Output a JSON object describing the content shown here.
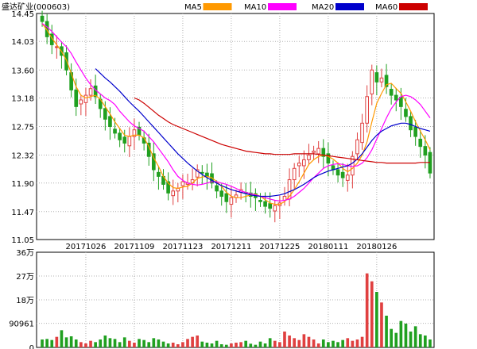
{
  "header": {
    "title": "盛达矿业(000603)"
  },
  "legend": [
    {
      "name": "MA5",
      "color": "#ff9900"
    },
    {
      "name": "MA10",
      "color": "#ff00ff"
    },
    {
      "name": "MA20",
      "color": "#0000cc"
    },
    {
      "name": "MA60",
      "color": "#cc0000"
    }
  ],
  "colors": {
    "up": "#e04040",
    "down": "#20a020",
    "grid": "#b0b0b0",
    "axis": "#000000"
  },
  "chart_data": [
    {
      "type": "candlestick",
      "ylim": [
        11.05,
        14.45
      ],
      "yticks": [
        "14.45",
        "14.03",
        "13.60",
        "13.18",
        "12.75",
        "12.32",
        "11.90",
        "11.47",
        "11.05"
      ],
      "xticks": [
        {
          "label": "20171026",
          "index": 9
        },
        {
          "label": "20171109",
          "index": 19
        },
        {
          "label": "20171123",
          "index": 29
        },
        {
          "label": "20171211",
          "index": 39
        },
        {
          "label": "20171225",
          "index": 49
        },
        {
          "label": "20180111",
          "index": 59
        },
        {
          "label": "20180126",
          "index": 69
        }
      ],
      "close": [
        14.33,
        14.1,
        13.98,
        13.95,
        13.82,
        13.6,
        13.3,
        13.05,
        13.15,
        13.22,
        13.32,
        13.2,
        13.02,
        12.86,
        12.75,
        12.65,
        12.55,
        12.5,
        12.6,
        12.7,
        12.62,
        12.5,
        12.3,
        12.1,
        12.0,
        11.88,
        11.75,
        11.78,
        11.82,
        11.92,
        11.9,
        11.95,
        12.1,
        12.05,
        12.0,
        11.9,
        11.78,
        11.7,
        11.62,
        11.68,
        11.72,
        11.8,
        11.75,
        11.7,
        11.68,
        11.62,
        11.55,
        11.52,
        11.56,
        11.6,
        11.7,
        11.95,
        12.12,
        12.2,
        12.25,
        12.32,
        12.38,
        12.42,
        12.3,
        12.2,
        12.1,
        12.02,
        11.98,
        12.02,
        12.3,
        12.55,
        12.8,
        13.2,
        13.6,
        13.42,
        13.48,
        13.35,
        13.22,
        13.15,
        13.05,
        12.9,
        12.7,
        12.6,
        12.45,
        12.32,
        12.05
      ],
      "ma_series": [
        {
          "name": "MA5",
          "values": [
            14.3,
            14.2,
            14.08,
            13.98,
            13.88,
            13.75,
            13.55,
            13.35,
            13.22,
            13.18,
            13.2,
            13.22,
            13.16,
            13.05,
            12.94,
            12.82,
            12.72,
            12.62,
            12.6,
            12.62,
            12.62,
            12.58,
            12.45,
            12.28,
            12.15,
            12.0,
            11.9,
            11.83,
            11.82,
            11.84,
            11.85,
            11.9,
            11.97,
            11.99,
            12.0,
            11.98,
            11.92,
            11.85,
            11.76,
            11.7,
            11.68,
            11.68,
            11.7,
            11.72,
            11.73,
            11.7,
            11.65,
            11.6,
            11.58,
            11.58,
            11.62,
            11.7,
            11.8,
            11.92,
            12.05,
            12.18,
            12.25,
            12.3,
            12.32,
            12.3,
            12.26,
            12.2,
            12.12,
            12.07,
            12.12,
            12.2,
            12.32,
            12.52,
            12.82,
            13.1,
            13.25,
            13.38,
            13.4,
            13.32,
            13.25,
            13.12,
            12.98,
            12.82,
            12.68,
            12.55,
            12.4
          ]
        },
        {
          "name": "MA10",
          "values": [
            14.3,
            14.25,
            14.18,
            14.1,
            14.02,
            13.95,
            13.85,
            13.72,
            13.6,
            13.48,
            13.38,
            13.3,
            13.24,
            13.18,
            13.14,
            13.08,
            12.98,
            12.9,
            12.82,
            12.76,
            12.72,
            12.68,
            12.6,
            12.52,
            12.42,
            12.32,
            12.22,
            12.1,
            12.0,
            11.94,
            11.9,
            11.88,
            11.87,
            11.88,
            11.9,
            11.92,
            11.92,
            11.9,
            11.88,
            11.85,
            11.82,
            11.78,
            11.76,
            11.74,
            11.72,
            11.7,
            11.68,
            11.66,
            11.64,
            11.63,
            11.64,
            11.66,
            11.7,
            11.76,
            11.82,
            11.9,
            11.98,
            12.05,
            12.12,
            12.16,
            12.18,
            12.19,
            12.18,
            12.16,
            12.15,
            12.16,
            12.2,
            12.28,
            12.4,
            12.56,
            12.72,
            12.88,
            13.02,
            13.12,
            13.2,
            13.22,
            13.2,
            13.15,
            13.08,
            12.98,
            12.88
          ]
        },
        {
          "name": "MA20",
          "values": [
            null,
            null,
            null,
            null,
            null,
            null,
            null,
            null,
            null,
            null,
            null,
            13.62,
            13.55,
            13.48,
            13.42,
            13.35,
            13.28,
            13.2,
            13.12,
            13.05,
            12.98,
            12.9,
            12.82,
            12.74,
            12.66,
            12.58,
            12.5,
            12.42,
            12.34,
            12.27,
            12.2,
            12.14,
            12.08,
            12.03,
            11.98,
            11.94,
            11.9,
            11.86,
            11.83,
            11.8,
            11.78,
            11.76,
            11.74,
            11.72,
            11.71,
            11.7,
            11.7,
            11.7,
            11.71,
            11.72,
            11.74,
            11.77,
            11.8,
            11.84,
            11.88,
            11.93,
            11.98,
            12.02,
            12.05,
            12.08,
            12.1,
            12.12,
            12.14,
            12.16,
            12.2,
            12.26,
            12.34,
            12.44,
            12.54,
            12.62,
            12.68,
            12.72,
            12.76,
            12.78,
            12.8,
            12.8,
            12.78,
            12.75,
            12.72,
            12.7,
            12.68
          ]
        },
        {
          "name": "MA60",
          "values": [
            null,
            null,
            null,
            null,
            null,
            null,
            null,
            null,
            null,
            null,
            null,
            null,
            null,
            null,
            null,
            null,
            null,
            null,
            null,
            13.18,
            13.15,
            13.1,
            13.04,
            12.98,
            12.92,
            12.87,
            12.82,
            12.78,
            12.75,
            12.72,
            12.69,
            12.66,
            12.63,
            12.6,
            12.57,
            12.54,
            12.51,
            12.48,
            12.46,
            12.44,
            12.42,
            12.4,
            12.38,
            12.37,
            12.36,
            12.35,
            12.34,
            12.34,
            12.33,
            12.33,
            12.33,
            12.33,
            12.34,
            12.34,
            12.34,
            12.34,
            12.34,
            12.33,
            12.32,
            12.31,
            12.3,
            12.29,
            12.28,
            12.27,
            12.26,
            12.25,
            12.24,
            12.23,
            12.22,
            12.21,
            12.21,
            12.2,
            12.2,
            12.2,
            12.2,
            12.2,
            12.2,
            12.2,
            12.21,
            12.21,
            12.21
          ]
        }
      ]
    },
    {
      "type": "bar",
      "name": "volume",
      "ylim": [
        0,
        360000
      ],
      "yticks": [
        "36万",
        "27万",
        "18万",
        "90961",
        "0"
      ],
      "yticks_values": [
        360000,
        270000,
        180000,
        90961,
        0
      ],
      "values": [
        30000,
        32000,
        28000,
        40000,
        65000,
        38000,
        42000,
        30000,
        20000,
        15000,
        25000,
        20000,
        30000,
        45000,
        35000,
        32000,
        20000,
        38000,
        25000,
        18000,
        32000,
        28000,
        20000,
        35000,
        30000,
        22000,
        15000,
        18000,
        12000,
        20000,
        32000,
        40000,
        45000,
        22000,
        18000,
        15000,
        25000,
        12000,
        10000,
        15000,
        18000,
        20000,
        25000,
        14000,
        10000,
        22000,
        15000,
        35000,
        25000,
        20000,
        60000,
        45000,
        35000,
        28000,
        50000,
        40000,
        30000,
        15000,
        30000,
        20000,
        25000,
        20000,
        28000,
        35000,
        25000,
        30000,
        40000,
        280000,
        250000,
        210000,
        170000,
        120000,
        70000,
        55000,
        100000,
        90000,
        60000,
        80000,
        50000,
        45000,
        30000
      ]
    }
  ]
}
